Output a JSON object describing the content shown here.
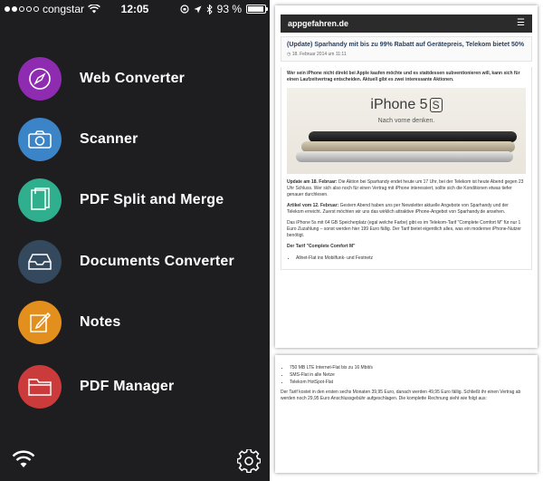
{
  "status_bar": {
    "carrier": "congstar",
    "time": "12:05",
    "battery_text": "93 %",
    "battery_level": 0.93
  },
  "menu": {
    "items": [
      {
        "label": "Web Converter",
        "icon": "compass-icon",
        "color": "#8e2bb0"
      },
      {
        "label": "Scanner",
        "icon": "camera-icon",
        "color": "#3b84c7"
      },
      {
        "label": "PDF Split and Merge",
        "icon": "documents-icon",
        "color": "#2faf8e"
      },
      {
        "label": "Documents Converter",
        "icon": "tray-icon",
        "color": "#34485e"
      },
      {
        "label": "Notes",
        "icon": "pencil-icon",
        "color": "#e38f1e"
      },
      {
        "label": "PDF Manager",
        "icon": "folder-icon",
        "color": "#cc3b3b"
      }
    ],
    "bottom_left_icon": "wifi-icon",
    "bottom_right_icon": "gear-icon"
  },
  "article": {
    "site": "appgefahren.de",
    "title": "(Update) Sparhandy mit bis zu 99% Rabatt auf Gerätepreis, Telekom bietet 50%",
    "date": "18. Februar 2014 um 11:11",
    "intro": "Wer sein iPhone nicht direkt bei Apple kaufen möchte und es stattdessen subventionieren will, kann sich für einen Laufzeitvertrag entscheiden. Aktuell gibt es zwei interessante Aktionen.",
    "banner_brand": "iPhone 5",
    "banner_brand_suffix": "S",
    "banner_tagline": "Nach vorne denken.",
    "update_lead": "Update am 18. Februar:",
    "update_text": " Die Aktion bei Sparhandy endet heute um 17 Uhr, bei der Telekom ist heute Abend gegen 23 Uhr Schluss. Wer sich also noch für einen Vertrag mit iPhone interessiert, sollte sich die Konditionen etwas tiefer genauer durchlesen.",
    "article_lead": "Artikel vom 12. Februar:",
    "article_text": " Gestern Abend haben uns per Newsletter aktuelle Angebote von Sparhandy und der Telekom erreicht. Zuerst möchten wir uns das wirklich attraktive iPhone-Angebot von Sparhandy.de ansehen.",
    "para3": "Das iPhone 5s mit 64 GB Speicherplatz (egal welche Farbe) gibt es im Telekom-Tarif \"Complete Comfort M\" für nur 1 Euro Zuzahlung – sonst werden hier 199 Euro fällig. Der Tarif bietet eigentlich alles, was ein moderner iPhone-Nutzer benötigt.",
    "tariff_heading": "Der Tarif \"Complete Comfort M\"",
    "bullet_top": "Allnet-Flat ins Mobilfunk- und Festnetz",
    "bullets_bottom": [
      "750 MB LTE Internet-Flat bis zu 16 Mbit/s",
      "SMS-Flat in alle Netze",
      "Telekom HotSpot-Flat"
    ],
    "para_bottom": "Der Tarif kostet in den ersten sechs Monaten 39,95 Euro, danach werden 49,95 Euro fällig. Schließt ihr einen Vertrag ab werden noch 29,95 Euro Anschlussgebühr aufgeschlagen. Die komplette Rechnung sieht wie folgt aus:"
  }
}
